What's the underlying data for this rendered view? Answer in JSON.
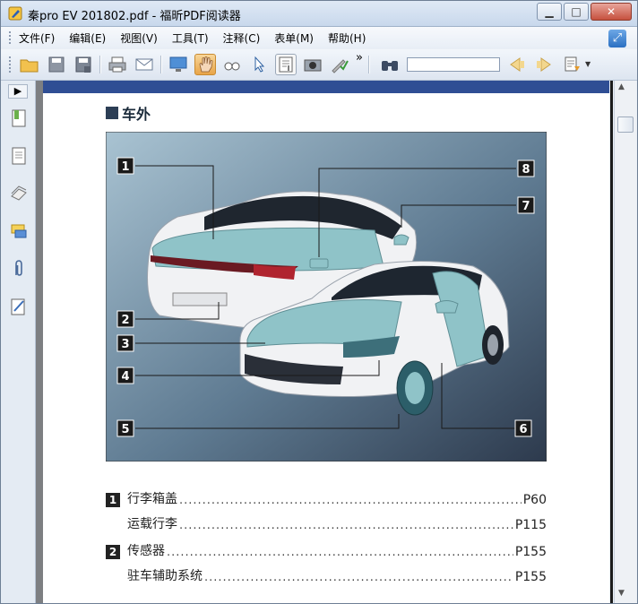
{
  "window": {
    "title": "秦pro EV 201802.pdf - 福昕PDF阅读器",
    "minimize_label": "▁",
    "maximize_label": "□",
    "close_label": "✕"
  },
  "menu": [
    "文件(F)",
    "编辑(E)",
    "视图(V)",
    "工具(T)",
    "注释(C)",
    "表单(M)",
    "帮助(H)"
  ],
  "toolbar": {
    "search_value": "",
    "overflow_label": "»"
  },
  "document": {
    "section_title": "车外",
    "callouts": [
      "1",
      "2",
      "3",
      "4",
      "5",
      "6",
      "7",
      "8"
    ],
    "toc": [
      {
        "num": "1",
        "label": "行李箱盖",
        "page": "P60"
      },
      {
        "num": "",
        "label": "运载行李",
        "page": "P115"
      },
      {
        "num": "2",
        "label": "传感器",
        "page": "P155"
      },
      {
        "num": "",
        "label": "驻车辅助系统",
        "page": "P155"
      }
    ]
  },
  "colors": {
    "accent_bar": "#2f4e94",
    "highlight_teal": "#8fc3c8"
  }
}
